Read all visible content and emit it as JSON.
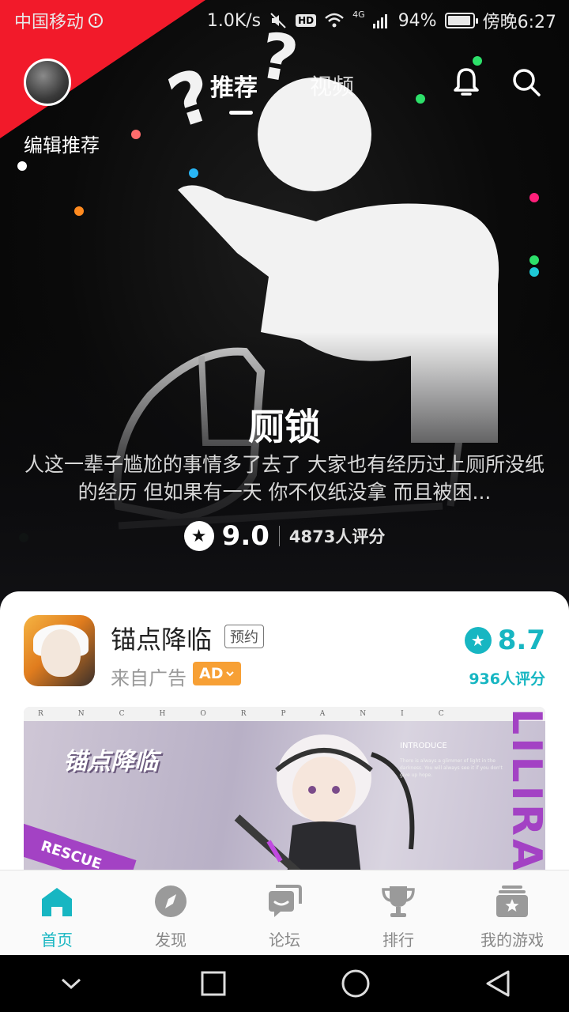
{
  "status_bar": {
    "carrier": "中国移动",
    "speed": "1.0K/s",
    "network": "4G",
    "battery_percent": "94%",
    "battery_level": 0.94,
    "time": "傍晚6:27",
    "hd_label": "HD"
  },
  "header": {
    "edit_label": "编辑推荐",
    "tabs": [
      {
        "label": "推荐",
        "active": true
      },
      {
        "label": "视频",
        "active": false
      }
    ],
    "icons": [
      "bell-icon",
      "search-icon"
    ]
  },
  "featured": {
    "title": "厕锁",
    "description": "人这一辈子尴尬的事情多了去了 大家也有经历过上厕所没纸的经历 但如果有一天 你不仅纸没拿 而且被困...",
    "score": "9.0",
    "rating_count": "4873人评分"
  },
  "ad_card": {
    "name": "锚点降临",
    "tag": "预约",
    "source": "来自广告",
    "ad_label": "AD",
    "score": "8.7",
    "rating_count": "936人评分",
    "banner": {
      "strip_letters": "RNCHORPANIC",
      "logo": "锚点降临",
      "intro_title": "INTRODUCE",
      "intro_text": "There is always a glimmer of light in the darkness. You will always see it if you don't give up hope.",
      "vertical_text": "LILIRA",
      "rescue_text": "RESCUE"
    }
  },
  "bottom_nav": [
    {
      "label": "首页",
      "icon": "home-icon",
      "active": true
    },
    {
      "label": "发现",
      "icon": "compass-icon",
      "active": false
    },
    {
      "label": "论坛",
      "icon": "forum-icon",
      "active": false
    },
    {
      "label": "排行",
      "icon": "trophy-icon",
      "active": false
    },
    {
      "label": "我的游戏",
      "icon": "game-box-icon",
      "active": false
    }
  ],
  "system_nav": [
    "chevron-down-icon",
    "recents-icon",
    "home-circle-icon",
    "back-icon"
  ],
  "colors": {
    "accent": "#17b6c2",
    "ribbon": "#f21a2a",
    "ad_badge": "#f7a035",
    "banner_purple": "#a342c4"
  }
}
